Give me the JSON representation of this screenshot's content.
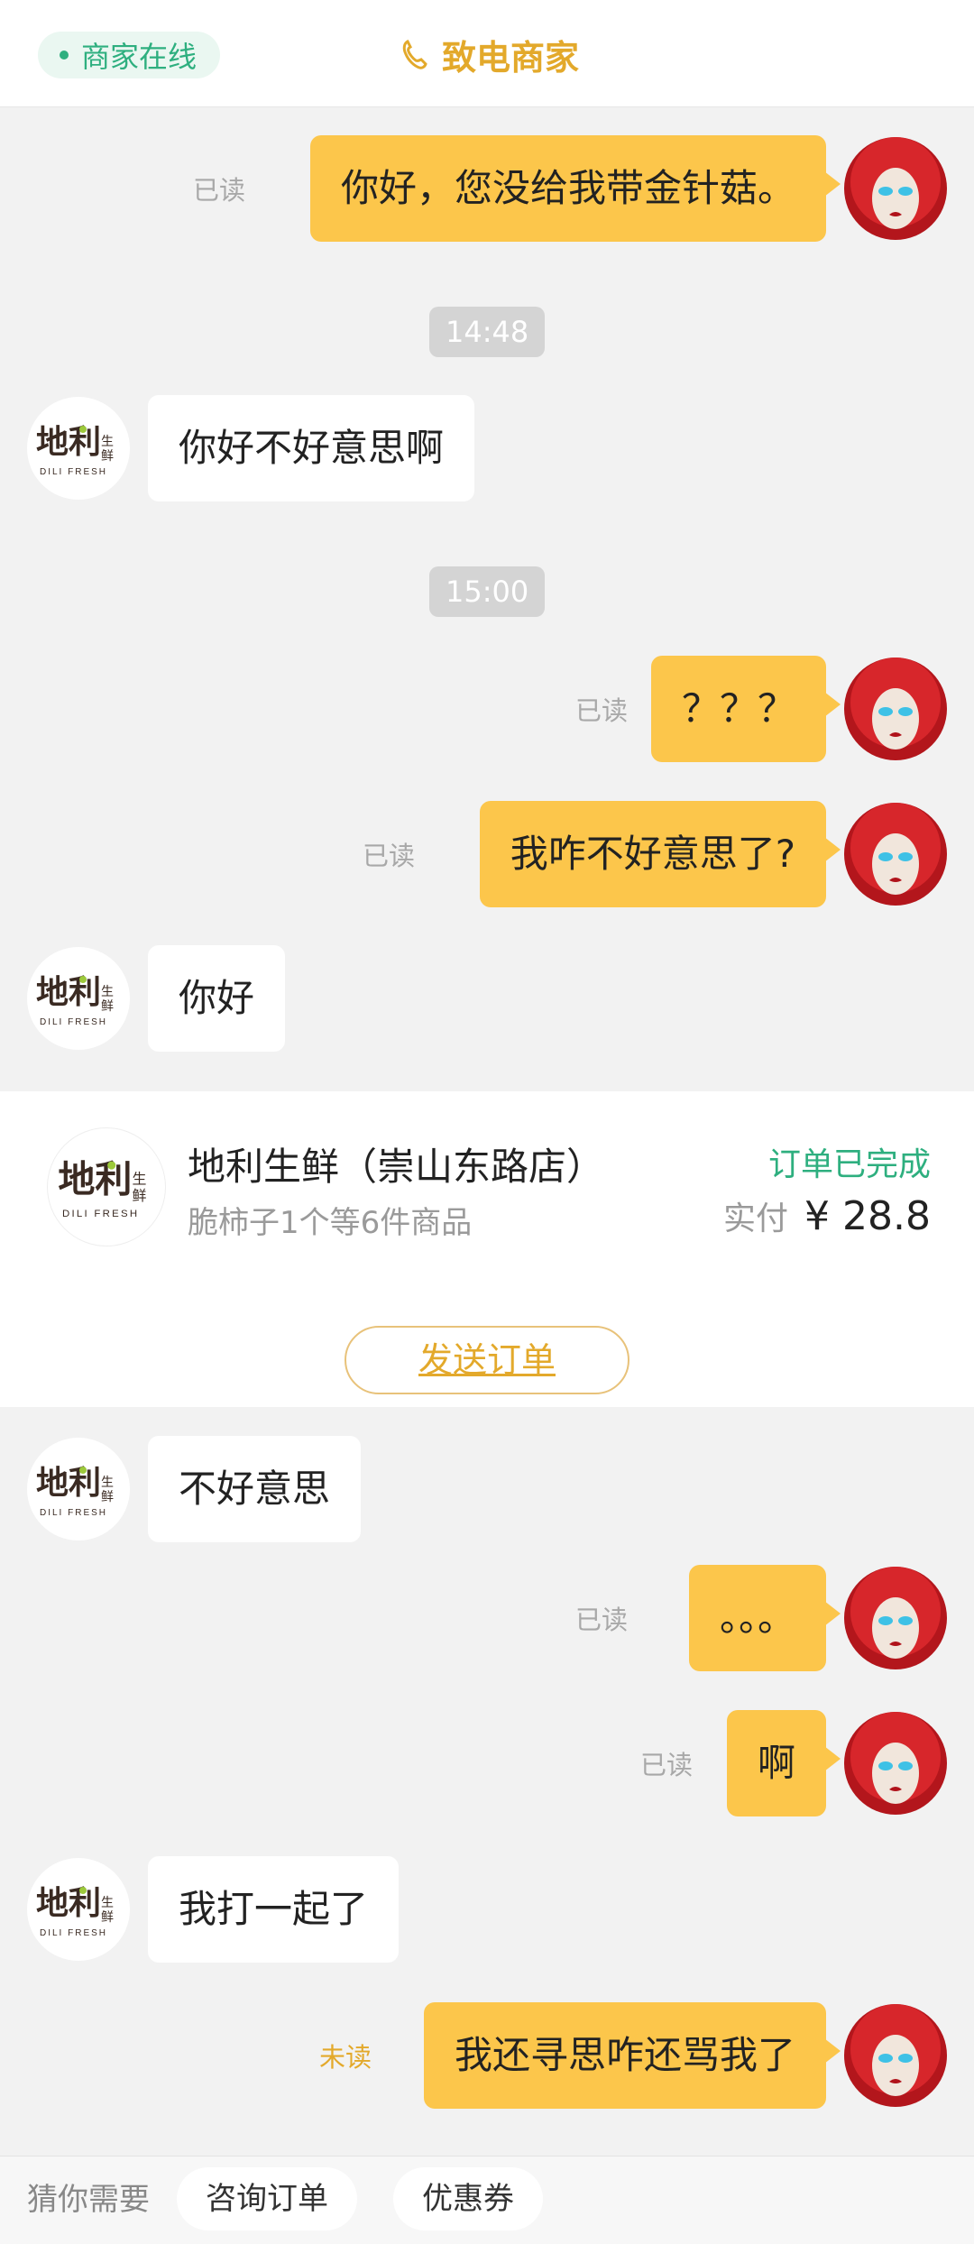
{
  "header": {
    "online_label": "商家在线",
    "call_label": "致电商家"
  },
  "messages": [
    {
      "side": "out",
      "text": "你好，您没给我带金针菇。",
      "status": "已读"
    },
    {
      "type": "time",
      "text": "14:48"
    },
    {
      "side": "in",
      "text": "你好不好意思啊"
    },
    {
      "type": "time",
      "text": "15:00"
    },
    {
      "side": "out",
      "text": "？？？",
      "status": "已读"
    },
    {
      "side": "out",
      "text": "我咋不好意思了?",
      "status": "已读"
    },
    {
      "side": "in",
      "text": "你好"
    },
    {
      "side": "in",
      "text": "不好意思"
    },
    {
      "side": "out",
      "text": "。。。",
      "status": "已读"
    },
    {
      "side": "out",
      "text": "啊",
      "status": "已读"
    },
    {
      "side": "in",
      "text": "我打一起了"
    },
    {
      "side": "out",
      "text": "我还寻思咋还骂我了",
      "status": "未读"
    }
  ],
  "order": {
    "shop_name": "地利生鲜（崇山东路店）",
    "items_summary": "脆柿子1个等6件商品",
    "status": "订单已完成",
    "paid_label": "实付",
    "paid_amount": "¥ 28.8",
    "send_button": "发送订单"
  },
  "shop_logo": {
    "text_main": "地利",
    "text_side": "生鲜",
    "text_en": "DILI FRESH"
  },
  "bottom": {
    "guess_label": "猜你需要",
    "chips": [
      "咨询订单",
      "优惠券"
    ]
  },
  "colors": {
    "accent_green": "#2eaf7f",
    "accent_gold": "#e3a92b",
    "bubble_out": "#fcc64b"
  }
}
